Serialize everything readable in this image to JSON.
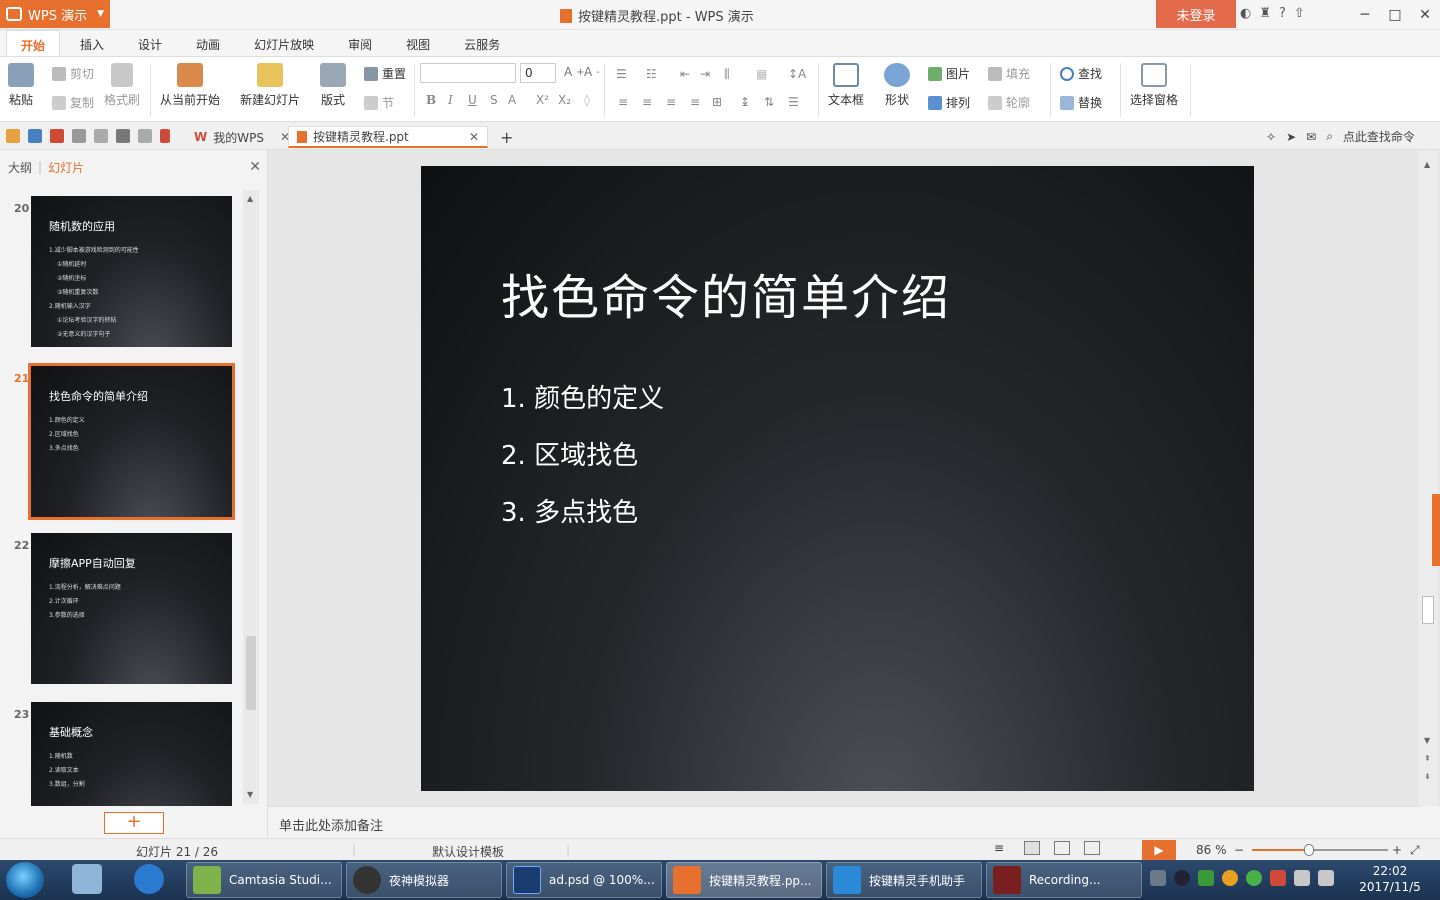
{
  "app": {
    "menu_label": "WPS 演示",
    "window_title": "按键精灵教程.ppt - WPS 演示",
    "login_label": "未登录"
  },
  "ribbon_tabs": [
    "开始",
    "插入",
    "设计",
    "动画",
    "幻灯片放映",
    "审阅",
    "视图",
    "云服务"
  ],
  "ribbon": {
    "paste": "粘贴",
    "cut": "剪切",
    "copy": "复制",
    "format_painter": "格式刷",
    "from_current": "从当前开始",
    "new_slide": "新建幻灯片",
    "layout": "版式",
    "reset": "重置",
    "section": "节",
    "font_size": "0",
    "textbox": "文本框",
    "shape": "形状",
    "picture": "图片",
    "fill": "填充",
    "arrange": "排列",
    "outline": "轮廓",
    "find": "查找",
    "replace": "替换",
    "select_pane": "选择窗格"
  },
  "doc_tabs": {
    "my_wps": "我的WPS",
    "current_doc": "按键精灵教程.ppt"
  },
  "search_command": "点此查找命令",
  "left_pane": {
    "tab_outline": "大纲",
    "tab_slides": "幻灯片"
  },
  "thumbnails": [
    {
      "num": "20",
      "title": "随机数的应用",
      "lines": [
        "1.减少脚本被游戏检测到的可能性",
        "①随机延时",
        "②随机坐标",
        "③随机重复次数",
        "2.随机输入汉字",
        "①论坛考验汉字的转帖",
        "②无意义的汉字句子"
      ]
    },
    {
      "num": "21",
      "title": "找色命令的简单介绍",
      "lines": [
        "1.颜色的定义",
        "2.区域找色",
        "3.多点找色"
      ]
    },
    {
      "num": "22",
      "title": "摩擦APP自动回复",
      "lines": [
        "1.流程分析，解决难点问题",
        "2.计次循环",
        "3.参数的选择"
      ]
    },
    {
      "num": "23",
      "title": "基础概念",
      "lines": [
        "1.随机数",
        "2.读取文本",
        "3.数组，分割"
      ]
    }
  ],
  "slide": {
    "title": "找色命令的简单介绍",
    "items": [
      "1. 颜色的定义",
      "2. 区域找色",
      "3. 多点找色"
    ]
  },
  "notes_placeholder": "单击此处添加备注",
  "status": {
    "slide_counter": "幻灯片 21 / 26",
    "template": "默认设计模板",
    "zoom": "86 %",
    "zoom_value": 0.86
  },
  "taskbar": {
    "tasks": [
      "Camtasia Studi...",
      "夜神模拟器",
      "ad.psd @ 100%...",
      "按键精灵教程.pp...",
      "按键精灵手机助手",
      "Recording..."
    ],
    "time": "22:02",
    "date": "2017/11/5"
  },
  "colors": {
    "accent": "#e8702e",
    "login": "#e36a4b",
    "taskbar": "#1b3250"
  }
}
